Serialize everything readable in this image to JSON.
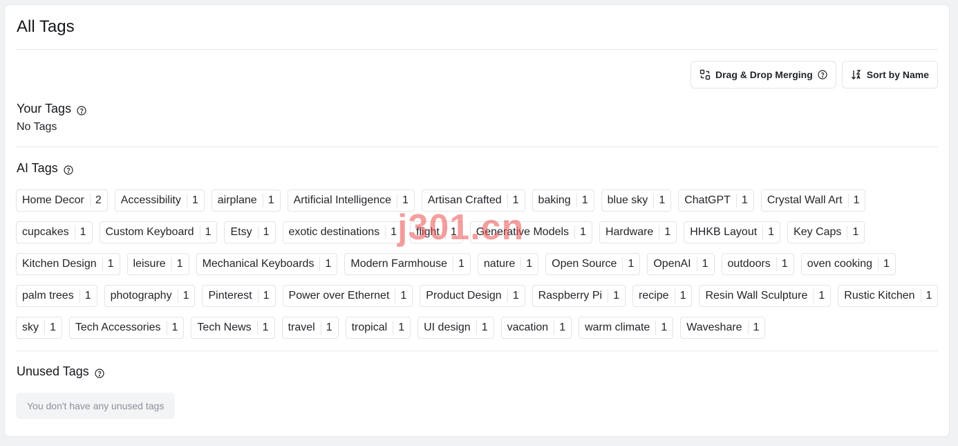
{
  "page": {
    "title": "All Tags"
  },
  "toolbar": {
    "merge_label": "Drag & Drop Merging",
    "sort_label": "Sort by Name"
  },
  "your_tags": {
    "title": "Your Tags",
    "empty_text": "No Tags"
  },
  "ai_tags": {
    "title": "AI Tags",
    "items": [
      {
        "name": "Home Decor",
        "count": "2"
      },
      {
        "name": "Accessibility",
        "count": "1"
      },
      {
        "name": "airplane",
        "count": "1"
      },
      {
        "name": "Artificial Intelligence",
        "count": "1"
      },
      {
        "name": "Artisan Crafted",
        "count": "1"
      },
      {
        "name": "baking",
        "count": "1"
      },
      {
        "name": "blue sky",
        "count": "1"
      },
      {
        "name": "ChatGPT",
        "count": "1"
      },
      {
        "name": "Crystal Wall Art",
        "count": "1"
      },
      {
        "name": "cupcakes",
        "count": "1"
      },
      {
        "name": "Custom Keyboard",
        "count": "1"
      },
      {
        "name": "Etsy",
        "count": "1"
      },
      {
        "name": "exotic destinations",
        "count": "1"
      },
      {
        "name": "flight",
        "count": "1"
      },
      {
        "name": "Generative Models",
        "count": "1"
      },
      {
        "name": "Hardware",
        "count": "1"
      },
      {
        "name": "HHKB Layout",
        "count": "1"
      },
      {
        "name": "Key Caps",
        "count": "1"
      },
      {
        "name": "Kitchen Design",
        "count": "1"
      },
      {
        "name": "leisure",
        "count": "1"
      },
      {
        "name": "Mechanical Keyboards",
        "count": "1"
      },
      {
        "name": "Modern Farmhouse",
        "count": "1"
      },
      {
        "name": "nature",
        "count": "1"
      },
      {
        "name": "Open Source",
        "count": "1"
      },
      {
        "name": "OpenAI",
        "count": "1"
      },
      {
        "name": "outdoors",
        "count": "1"
      },
      {
        "name": "oven cooking",
        "count": "1"
      },
      {
        "name": "palm trees",
        "count": "1"
      },
      {
        "name": "photography",
        "count": "1"
      },
      {
        "name": "Pinterest",
        "count": "1"
      },
      {
        "name": "Power over Ethernet",
        "count": "1"
      },
      {
        "name": "Product Design",
        "count": "1"
      },
      {
        "name": "Raspberry Pi",
        "count": "1"
      },
      {
        "name": "recipe",
        "count": "1"
      },
      {
        "name": "Resin Wall Sculpture",
        "count": "1"
      },
      {
        "name": "Rustic Kitchen",
        "count": "1"
      },
      {
        "name": "sky",
        "count": "1"
      },
      {
        "name": "Tech Accessories",
        "count": "1"
      },
      {
        "name": "Tech News",
        "count": "1"
      },
      {
        "name": "travel",
        "count": "1"
      },
      {
        "name": "tropical",
        "count": "1"
      },
      {
        "name": "UI design",
        "count": "1"
      },
      {
        "name": "vacation",
        "count": "1"
      },
      {
        "name": "warm climate",
        "count": "1"
      },
      {
        "name": "Waveshare",
        "count": "1"
      }
    ]
  },
  "unused_tags": {
    "title": "Unused Tags",
    "empty_text": "You don't have any unused tags"
  },
  "watermark": {
    "text": "j301.cn"
  },
  "icons": {
    "merge": "merge-grid-icon",
    "sort": "sort-arrows-icon",
    "help": "question-circle-icon"
  }
}
